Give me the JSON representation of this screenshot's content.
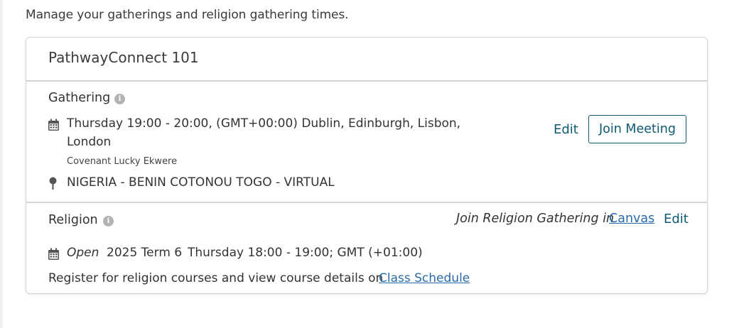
{
  "intro_text": "Manage your gatherings and religion gathering times.",
  "card": {
    "title": "PathwayConnect 101"
  },
  "gathering": {
    "label": "Gathering",
    "schedule_line1": "Thursday 19:00 - 20:00, (GMT+00:00) Dublin, Edinburgh, Lisbon,",
    "schedule_line2": "London",
    "facilitator": "Covenant Lucky Ekwere",
    "location": "NIGERIA - BENIN COTONOU TOGO - VIRTUAL",
    "edit_label": "Edit",
    "join_label": "Join Meeting"
  },
  "religion": {
    "label": "Religion",
    "join_prefix": "Join Religion Gathering in",
    "canvas_link": "Canvas",
    "edit_label": "Edit",
    "status": "Open",
    "term": "2025 Term 6",
    "schedule": "Thursday 18:00 - 19:00; GMT (+01:00)",
    "register_text": "Register for religion courses and view course details on",
    "class_schedule_link": "Class Schedule"
  },
  "icons": {
    "info": "info-icon",
    "calendar": "calendar-icon",
    "location": "map-pin-icon"
  },
  "colors": {
    "accent": "#0f5a73",
    "link": "#2a6aa8",
    "border": "#d6d6d6",
    "info_icon": "#b3b3b3"
  }
}
